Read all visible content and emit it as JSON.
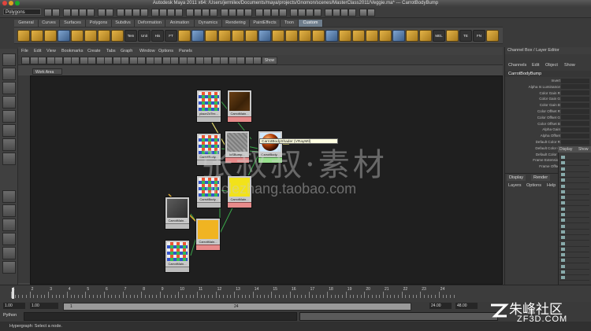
{
  "window": {
    "title": "Autodesk Maya 2011 x64: /Users/jermilex/Documents/maya/projects/Gnomon/scenes/MasterClass2011/Veggie.ma*  ---  CarrotBodyBump"
  },
  "status_line": {
    "mode": "Polygons"
  },
  "shelf": {
    "tabs": [
      "General",
      "Curves",
      "Surfaces",
      "Polygons",
      "Subdivs",
      "Deformation",
      "Animation",
      "Dynamics",
      "Rendering",
      "PaintEffects",
      "Toon",
      "Custom"
    ],
    "active_tab": "Custom",
    "text_icons": [
      "Tem",
      "Unit",
      "His",
      "FT",
      "MEL",
      "TE",
      "FN"
    ]
  },
  "hypergraph": {
    "menu": [
      "File",
      "Edit",
      "View",
      "Bookmarks",
      "Create",
      "Tabs",
      "Graph",
      "Window",
      "Options",
      "Panels"
    ],
    "show_button": "Show",
    "work_tab": "Work Area",
    "tooltip": "CarrotBodyShader (VRayMtl)",
    "nodes": [
      {
        "label": "placeZdTex...",
        "swatch": "checker",
        "bar": "gray"
      },
      {
        "label": "CarrotMain...",
        "swatch": "wood",
        "bar": "red"
      },
      {
        "label": "CarrotBody...",
        "swatch": "checker",
        "bar": "gray"
      },
      {
        "label": "lcSBump...",
        "swatch": "noise",
        "bar": "red"
      },
      {
        "label": "CarrotBody...",
        "swatch": "sphere",
        "bar": "green"
      },
      {
        "label": "CarrotBody...",
        "swatch": "checker",
        "bar": "gray"
      },
      {
        "label": "CarrotMain...",
        "swatch": "yellow",
        "bar": "red"
      },
      {
        "label": "CarrotMain...",
        "swatch": "place",
        "bar": "gray"
      },
      {
        "label": "CarrotMain...",
        "swatch": "orange",
        "bar": "red"
      },
      {
        "label": "CarrotMain...",
        "swatch": "checker",
        "bar": "gray"
      }
    ]
  },
  "channel_box": {
    "title": "Channel Box / Layer Editor",
    "menu": [
      "Channels",
      "Edit",
      "Object",
      "Show"
    ],
    "node": "CarrotBodyBump",
    "attributes": [
      "Invert",
      "Alpha Is Luminance",
      "Color Gain R",
      "Color Gain G",
      "Color Gain B",
      "Color Offset R",
      "Color Offset G",
      "Color Offset B",
      "Alpha Gain",
      "Alpha Offset",
      "Default Color R",
      "Default Color G",
      "Default Color B",
      "Frame Extension",
      "Frame Offset"
    ]
  },
  "layer_editor": {
    "tabs": [
      "Display",
      "Render"
    ],
    "menu": [
      "Layers",
      "Options",
      "Help"
    ]
  },
  "display_window": {
    "tabs": [
      "Display",
      "Show"
    ]
  },
  "time_slider": {
    "ticks": [
      "1",
      "2",
      "3",
      "4",
      "5",
      "6",
      "7",
      "8",
      "9",
      "10",
      "11",
      "12",
      "13",
      "14",
      "15",
      "16",
      "17",
      "18",
      "19",
      "20",
      "21",
      "22",
      "23",
      "24"
    ],
    "current_frame": "1"
  },
  "range_slider": {
    "start": "1.00",
    "playback_start": "1.00",
    "range_start_label": "1",
    "range_end_label": "24",
    "playback_end": "24.00",
    "end": "48.00"
  },
  "command_line": {
    "label": "Python"
  },
  "help_line": {
    "text": "Hypergraph: Select a node."
  },
  "watermark": {
    "cn": "张叔叔·素材",
    "url": "unclezhang.taobao.com"
  },
  "corner_logo": {
    "cn": "朱峰社区",
    "url": "ZF3D.COM"
  }
}
